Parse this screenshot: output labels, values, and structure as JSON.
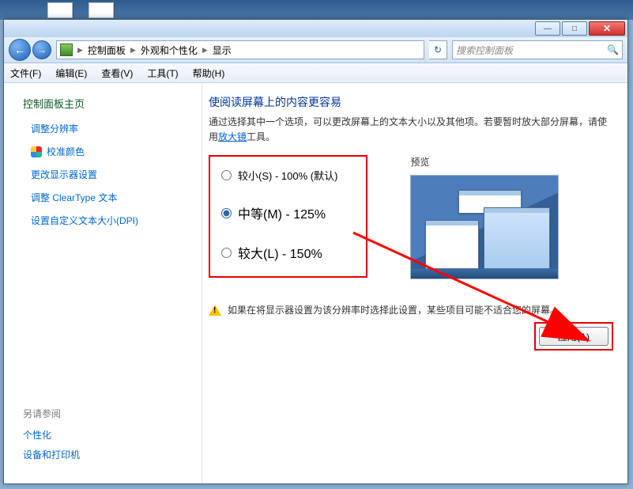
{
  "window": {
    "minimize_glyph": "—",
    "maximize_glyph": "□",
    "close_glyph": "✕"
  },
  "nav": {
    "back_glyph": "←",
    "fwd_glyph": "→",
    "refresh_glyph": "↻",
    "search_glyph": "🔍"
  },
  "breadcrumb": {
    "root": "控制面板",
    "level1": "外观和个性化",
    "level2": "显示"
  },
  "search_placeholder": "搜索控制面板",
  "menu": {
    "file": "文件(F)",
    "edit": "编辑(E)",
    "view": "查看(V)",
    "tools": "工具(T)",
    "help": "帮助(H)"
  },
  "sidebar": {
    "home": "控制面板主页",
    "items": [
      "调整分辨率",
      "校准颜色",
      "更改显示器设置",
      "调整 ClearType 文本",
      "设置自定义文本大小(DPI)"
    ],
    "see_also_title": "另请参阅",
    "see_also": [
      "个性化",
      "设备和打印机"
    ]
  },
  "main": {
    "heading": "使阅读屏幕上的内容更容易",
    "desc_prefix": "通过选择其中一个选项，可以更改屏幕上的文本大小以及其他项。若要暂时放大部分屏幕，请使用",
    "desc_link": "放大镜",
    "desc_suffix": "工具。",
    "options": [
      {
        "label": "较小(S) - 100% (默认)",
        "value": "100"
      },
      {
        "label": "中等(M) - 125%",
        "value": "125"
      },
      {
        "label": "较大(L) - 150%",
        "value": "150"
      }
    ],
    "selected": "125",
    "preview_label": "预览",
    "warning": "如果在将显示器设置为该分辨率时选择此设置，某些项目可能不适合您的屏幕。",
    "apply_label": "应用(A)"
  }
}
